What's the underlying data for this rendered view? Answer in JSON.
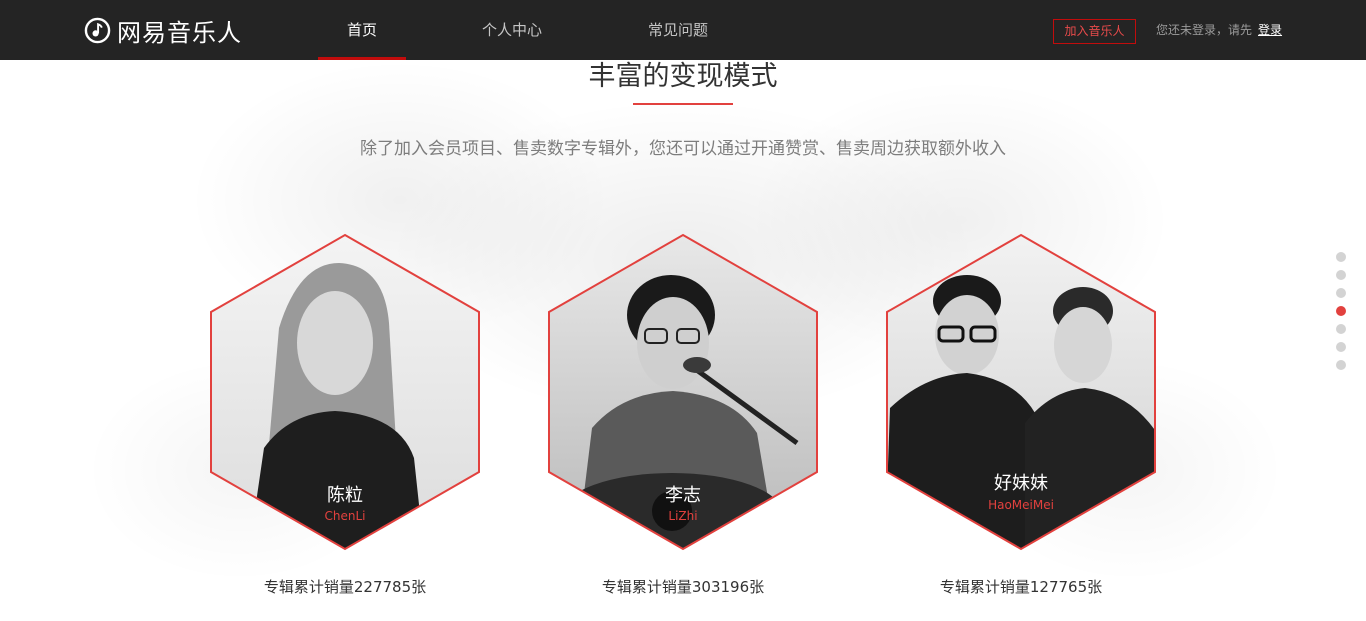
{
  "header": {
    "logo_text": "网易音乐人",
    "nav": [
      {
        "label": "首页",
        "active": true
      },
      {
        "label": "个人中心",
        "active": false
      },
      {
        "label": "常见问题",
        "active": false
      }
    ],
    "join_button": "加入音乐人",
    "login_prompt": "您还未登录，请先",
    "login_link": "登录"
  },
  "section": {
    "title": "丰富的变现模式",
    "subtitle": "除了加入会员项目、售卖数字专辑外，您还可以通过开通赞赏、售卖周边获取额外收入"
  },
  "artists": [
    {
      "name": "陈粒",
      "pinyin": "ChenLi",
      "sales": "专辑累计销量227785张"
    },
    {
      "name": "李志",
      "pinyin": "LiZhi",
      "sales": "专辑累计销量303196张"
    },
    {
      "name": "好妹妹",
      "pinyin": "HaoMeiMei",
      "sales": "专辑累计销量127765张"
    }
  ],
  "pager": {
    "total": 7,
    "active_index": 3
  },
  "colors": {
    "accent": "#e2413e",
    "nav_bg": "#242424",
    "brand_red": "#c20c0c"
  }
}
